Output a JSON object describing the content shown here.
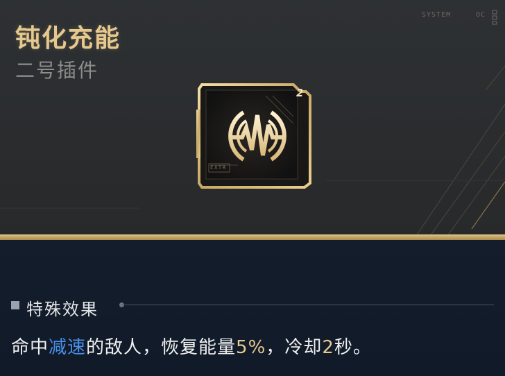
{
  "item": {
    "title": "钝化充能",
    "subtitle": "二号插件",
    "slot_badge": "2",
    "icon": "pulse-wave-emblem-icon",
    "chip_label": "EXTR"
  },
  "hud": {
    "left_text": "SYSTEM",
    "right_text": "OC"
  },
  "effect": {
    "section_title": "特殊效果",
    "text_before": "命中",
    "keyword": "减速",
    "text_middle": "的敌人，恢复能量",
    "value_percent": "5%",
    "text_after_value": "，冷却",
    "cooldown": "2",
    "text_end": "秒。"
  },
  "colors": {
    "accent_gold": "#e6c98f",
    "keyword_blue": "#4a8fe8",
    "bottom_bg": "#101a28",
    "top_bg": "#2c2e30"
  }
}
